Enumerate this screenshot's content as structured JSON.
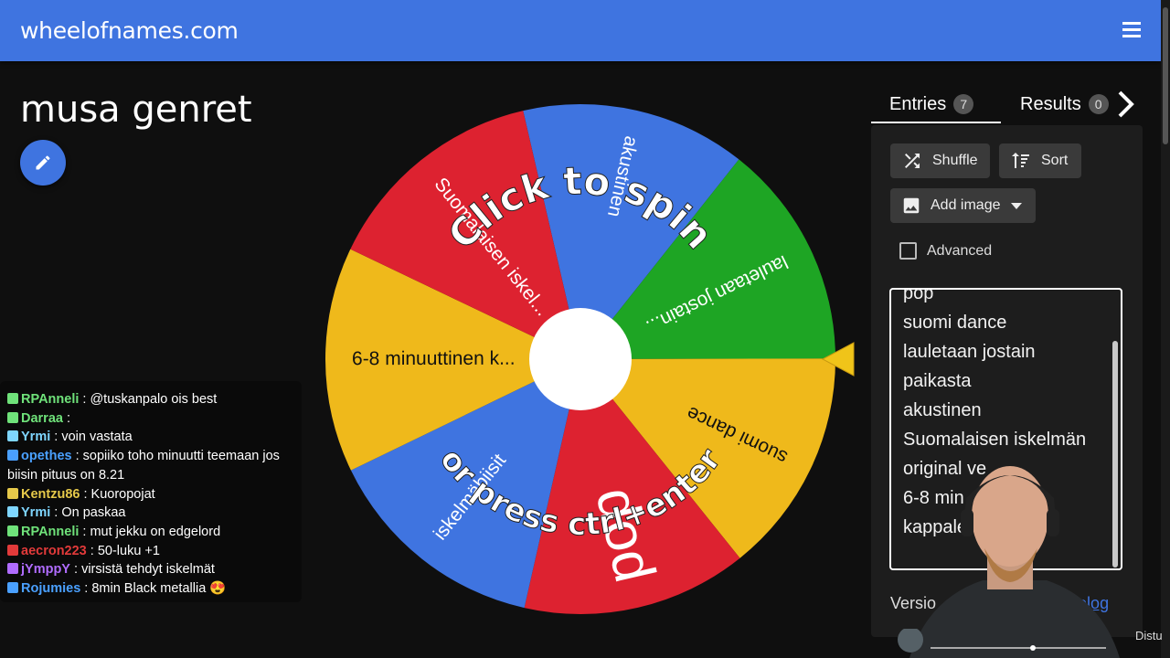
{
  "header": {
    "site_name": "wheelofnames.com",
    "menu_icon": "hamburger-menu-icon",
    "brand_color": "#3f74e0"
  },
  "wheel_page": {
    "title": "musa genret",
    "edit_icon": "pencil-icon"
  },
  "wheel": {
    "overlay_top": "Click to spin",
    "overlay_bottom": "or press ctrl+enter",
    "slices": [
      {
        "label": "akustinen",
        "color": "#3f74e0"
      },
      {
        "label": "lauletaan jostain...",
        "color": "#1ea524"
      },
      {
        "label": "suomi dance",
        "color": "#efb91b"
      },
      {
        "label": "pop",
        "color": "#dd2230"
      },
      {
        "label": "iskelmäbiisit",
        "color": "#3f74e0"
      },
      {
        "label": "6-8 minuuttinen k...",
        "color": "#efb91b"
      },
      {
        "label": "Suomalaisen iskel...",
        "color": "#dd2230"
      }
    ]
  },
  "panel": {
    "tabs": [
      {
        "label": "Entries",
        "count": "7"
      },
      {
        "label": "Results",
        "count": "0"
      }
    ],
    "shuffle_label": "Shuffle",
    "sort_label": "Sort",
    "add_image_label": "Add image",
    "advanced_label": "Advanced",
    "entries": [
      "pop",
      "suomi dance",
      "lauletaan jostain",
      "paikasta",
      "akustinen",
      "Suomalaisen iskelmän",
      "original ve",
      "6-8 min",
      "kappale"
    ],
    "version_label": "Versio",
    "changelog_label": "Changelog"
  },
  "chat": {
    "messages": [
      {
        "user": "RPAnneli",
        "color": "#6fe27a",
        "text": ": @tuskanpalo ois best"
      },
      {
        "user": "Darraa",
        "color": "#6fe27a",
        "text": ":"
      },
      {
        "user": "Yrmi",
        "color": "#7fd6ff",
        "text": ": voin vastata"
      },
      {
        "user": "opethes",
        "color": "#4aa0ff",
        "text": ": sopiiko toho minuutti teemaan jos biisin pituus on 8.21"
      },
      {
        "user": "Kentzu86",
        "color": "#e6c94a",
        "text": ": Kuoropojat"
      },
      {
        "user": "Yrmi",
        "color": "#7fd6ff",
        "text": ": On paskaa"
      },
      {
        "user": "RPAnneli",
        "color": "#6fe27a",
        "text": ": mut jekku on edgelord"
      },
      {
        "user": "aecron223",
        "color": "#e23a3a",
        "text": ": 50-luku +1"
      },
      {
        "user": "jYmppY",
        "color": "#b06cff",
        "text": ": virsistä tehdyt iskelmät"
      },
      {
        "user": "Rojumies",
        "color": "#4aa0ff",
        "text": ": 8min Black metallia 😍"
      }
    ]
  },
  "overlay": {
    "stream_label": "Distu"
  }
}
